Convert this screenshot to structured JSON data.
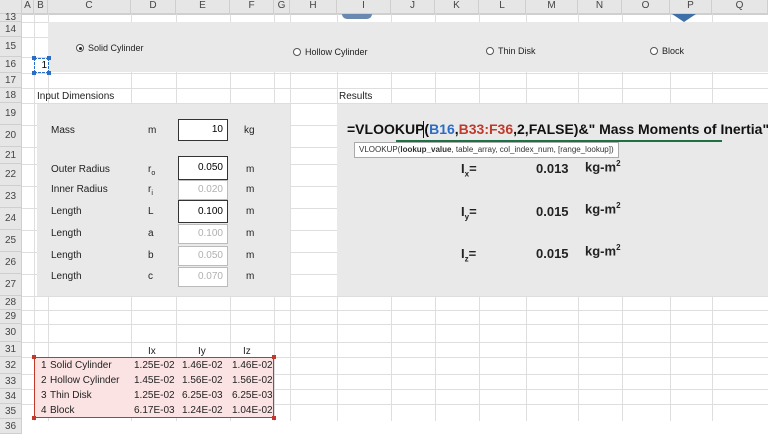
{
  "columns": [
    "A",
    "B",
    "C",
    "D",
    "E",
    "F",
    "G",
    "H",
    "I",
    "J",
    "K",
    "L",
    "M",
    "N",
    "O",
    "P",
    "Q"
  ],
  "rows": [
    "13",
    "14",
    "15",
    "16",
    "17",
    "18",
    "19",
    "20",
    "21",
    "22",
    "23",
    "24",
    "25",
    "26",
    "27",
    "28",
    "29",
    "30",
    "31",
    "32",
    "33",
    "34",
    "35",
    "36"
  ],
  "options": {
    "selected": "Solid Cylinder",
    "items": [
      "Solid Cylinder",
      "Hollow Cylinder",
      "Thin Disk",
      "Block"
    ],
    "linked_cell": "1"
  },
  "input": {
    "header": "Input Dimensions",
    "rows": [
      {
        "label": "Mass",
        "symbol": "m",
        "sub": "",
        "value": "10",
        "unit": "kg",
        "active": true
      },
      {
        "label": "Outer Radius",
        "symbol": "r",
        "sub": "o",
        "value": "0.050",
        "unit": "m",
        "active": true
      },
      {
        "label": "Inner Radius",
        "symbol": "r",
        "sub": "i",
        "value": "0.020",
        "unit": "m",
        "active": false
      },
      {
        "label": "Length",
        "symbol": "L",
        "sub": "",
        "value": "0.100",
        "unit": "m",
        "active": true
      },
      {
        "label": "Length",
        "symbol": "a",
        "sub": "",
        "value": "0.100",
        "unit": "m",
        "active": false
      },
      {
        "label": "Length",
        "symbol": "b",
        "sub": "",
        "value": "0.050",
        "unit": "m",
        "active": false
      },
      {
        "label": "Length",
        "symbol": "c",
        "sub": "",
        "value": "0.070",
        "unit": "m",
        "active": false
      }
    ]
  },
  "results": {
    "header": "Results",
    "formula": {
      "prefix": "=VLOOKUP(",
      "ref1": "B16",
      "sep1": ",",
      "ref2": "B33:F36",
      "rest": ",2,FALSE)&\" Mass Moments of Inertia\""
    },
    "tooltip": {
      "fn": "VLOOKUP(",
      "arg1": "lookup_value",
      "rest": ", table_array, col_index_num, [range_lookup])"
    },
    "items": [
      {
        "symbol": "I",
        "sub": "x",
        "eq": "=",
        "value": "0.013",
        "unit": "kg-m",
        "sup": "2"
      },
      {
        "symbol": "I",
        "sub": "y",
        "eq": "=",
        "value": "0.015",
        "unit": "kg-m",
        "sup": "2"
      },
      {
        "symbol": "I",
        "sub": "z",
        "eq": "=",
        "value": "0.015",
        "unit": "kg-m",
        "sup": "2"
      }
    ]
  },
  "table": {
    "headers": [
      "Ix",
      "Iy",
      "Iz"
    ],
    "rows": [
      {
        "n": "1",
        "name": "Solid Cylinder",
        "ix": "1.25E-02",
        "iy": "1.46E-02",
        "iz": "1.46E-02"
      },
      {
        "n": "2",
        "name": "Hollow Cylinder",
        "ix": "1.45E-02",
        "iy": "1.56E-02",
        "iz": "1.56E-02"
      },
      {
        "n": "3",
        "name": "Thin Disk",
        "ix": "1.25E-02",
        "iy": "6.25E-03",
        "iz": "6.25E-03"
      },
      {
        "n": "4",
        "name": "Block",
        "ix": "6.17E-03",
        "iy": "1.24E-02",
        "iz": "1.04E-02"
      }
    ]
  },
  "colors": {
    "accent_red": "#c0392b",
    "formula_blue": "#2b6cc4",
    "formula_red": "#c0392b",
    "panel": "#e9e9e9",
    "header_bg": "#e6e6e6",
    "underline_green": "#1e7145"
  }
}
